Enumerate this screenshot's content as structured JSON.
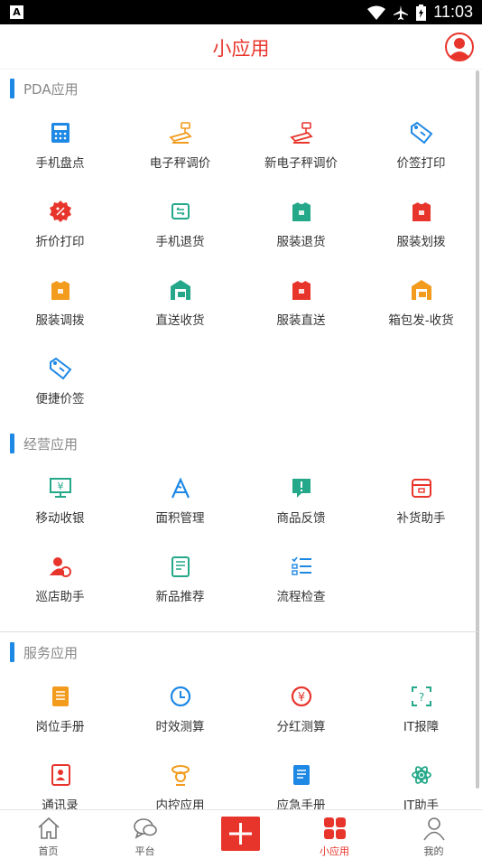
{
  "status_bar": {
    "time": "11:03",
    "notification_icon": "a-letter-icon"
  },
  "header": {
    "title": "小应用",
    "avatar_icon": "user-avatar-icon"
  },
  "sections": [
    {
      "label": "PDA应用",
      "items": [
        {
          "label": "手机盘点",
          "icon": "calculator-icon",
          "color": "#1e88e5"
        },
        {
          "label": "电子秤调价",
          "icon": "scale-icon",
          "color": "#f29b1d"
        },
        {
          "label": "新电子秤调价",
          "icon": "scale-icon",
          "color": "#e8352c"
        },
        {
          "label": "价签打印",
          "icon": "price-tag-icon",
          "color": "#1e88e5"
        },
        {
          "label": "折价打印",
          "icon": "discount-badge-icon",
          "color": "#e8352c"
        },
        {
          "label": "手机退货",
          "icon": "phone-return-icon",
          "color": "#24a889"
        },
        {
          "label": "服装退货",
          "icon": "clothes-return-icon",
          "color": "#24a889"
        },
        {
          "label": "服装划拨",
          "icon": "clothes-transfer-icon",
          "color": "#e8352c"
        },
        {
          "label": "服装调拨",
          "icon": "clothes-allocate-icon",
          "color": "#f29b1d"
        },
        {
          "label": "直送收货",
          "icon": "warehouse-receive-icon",
          "color": "#24a889"
        },
        {
          "label": "服装直送",
          "icon": "clothes-direct-icon",
          "color": "#e8352c"
        },
        {
          "label": "箱包发-收货",
          "icon": "warehouse-box-icon",
          "color": "#f29b1d"
        },
        {
          "label": "便捷价签",
          "icon": "quick-tag-icon",
          "color": "#1e88e5"
        }
      ]
    },
    {
      "label": "经营应用",
      "items": [
        {
          "label": "移动收银",
          "icon": "cashier-monitor-icon",
          "color": "#24a889"
        },
        {
          "label": "面积管理",
          "icon": "area-ruler-icon",
          "color": "#1e88e5"
        },
        {
          "label": "商品反馈",
          "icon": "feedback-icon",
          "color": "#24a889"
        },
        {
          "label": "补货助手",
          "icon": "restock-box-icon",
          "color": "#e8352c"
        },
        {
          "label": "巡店助手",
          "icon": "patrol-person-icon",
          "color": "#e8352c"
        },
        {
          "label": "新品推荐",
          "icon": "new-product-icon",
          "color": "#24a889"
        },
        {
          "label": "流程检查",
          "icon": "checklist-icon",
          "color": "#1e88e5"
        }
      ]
    },
    {
      "label": "服务应用",
      "items": [
        {
          "label": "岗位手册",
          "icon": "handbook-icon",
          "color": "#f29b1d"
        },
        {
          "label": "时效测算",
          "icon": "clock-icon",
          "color": "#1e88e5"
        },
        {
          "label": "分红测算",
          "icon": "yen-coin-icon",
          "color": "#e8352c"
        },
        {
          "label": "IT报障",
          "icon": "it-report-icon",
          "color": "#24a889"
        },
        {
          "label": "通讯录",
          "icon": "contacts-icon",
          "color": "#e8352c"
        },
        {
          "label": "内控应用",
          "icon": "control-icon",
          "color": "#f29b1d"
        },
        {
          "label": "应急手册",
          "icon": "emergency-book-icon",
          "color": "#1e88e5"
        },
        {
          "label": "IT助手",
          "icon": "atom-icon",
          "color": "#24a889"
        }
      ]
    }
  ],
  "bottom_nav": [
    {
      "label": "首页",
      "icon": "home-icon",
      "active": false
    },
    {
      "label": "平台",
      "icon": "chat-bubble-icon",
      "active": false
    },
    {
      "label": "",
      "icon": "plus-icon",
      "active": false
    },
    {
      "label": "小应用",
      "icon": "grid-apps-icon",
      "active": true
    },
    {
      "label": "我的",
      "icon": "person-icon",
      "active": false
    }
  ],
  "colors": {
    "accent": "#e8352c",
    "section_bar": "#1e88e5"
  }
}
